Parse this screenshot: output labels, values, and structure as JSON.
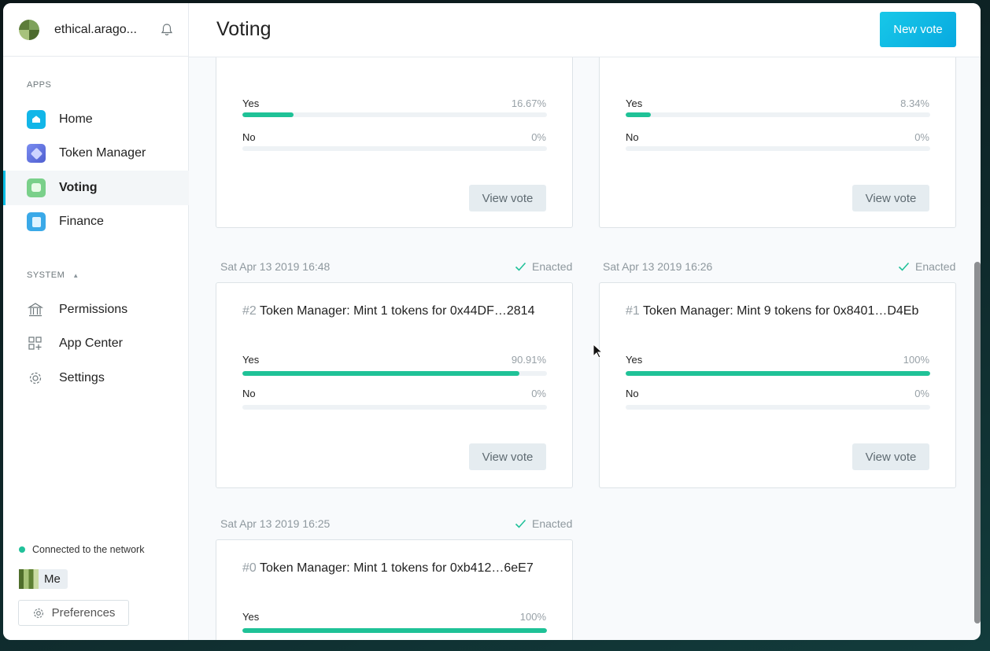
{
  "org": {
    "name": "ethical.arago..."
  },
  "sidebar": {
    "apps_label": "APPS",
    "apps": [
      {
        "label": "Home",
        "icon": "home-icon"
      },
      {
        "label": "Token Manager",
        "icon": "token-manager-icon"
      },
      {
        "label": "Voting",
        "icon": "voting-icon",
        "active": true
      },
      {
        "label": "Finance",
        "icon": "finance-icon"
      }
    ],
    "system_label": "SYSTEM",
    "system": [
      {
        "label": "Permissions",
        "icon": "bank-icon"
      },
      {
        "label": "App Center",
        "icon": "grid-plus-icon"
      },
      {
        "label": "Settings",
        "icon": "gear-icon"
      }
    ],
    "network_status": "Connected to the network",
    "user_label": "Me",
    "preferences_label": "Preferences"
  },
  "header": {
    "title": "Voting",
    "new_vote_label": "New vote"
  },
  "votes": {
    "top_left": {
      "yes_label": "Yes",
      "yes_pct": "16.67%",
      "yes_fraction": 0.1667,
      "no_label": "No",
      "no_pct": "0%",
      "no_fraction": 0,
      "button": "View vote"
    },
    "top_right": {
      "yes_label": "Yes",
      "yes_pct": "8.34%",
      "yes_fraction": 0.0834,
      "no_label": "No",
      "no_pct": "0%",
      "no_fraction": 0,
      "button": "View vote"
    },
    "v2": {
      "date": "Sat Apr 13 2019 16:48",
      "status": "Enacted",
      "number": "#2",
      "title": "Token Manager: Mint 1 tokens for 0x44DF…2814",
      "yes_label": "Yes",
      "yes_pct": "90.91%",
      "yes_fraction": 0.9091,
      "no_label": "No",
      "no_pct": "0%",
      "no_fraction": 0,
      "button": "View vote"
    },
    "v1": {
      "date": "Sat Apr 13 2019 16:26",
      "status": "Enacted",
      "number": "#1",
      "title": "Token Manager: Mint 9 tokens for 0x8401…D4Eb",
      "yes_label": "Yes",
      "yes_pct": "100%",
      "yes_fraction": 1.0,
      "no_label": "No",
      "no_pct": "0%",
      "no_fraction": 0,
      "button": "View vote"
    },
    "v0": {
      "date": "Sat Apr 13 2019 16:25",
      "status": "Enacted",
      "number": "#0",
      "title": "Token Manager: Mint 1 tokens for 0xb412…6eE7",
      "yes_label": "Yes",
      "yes_pct": "100%",
      "yes_fraction": 1.0
    }
  },
  "colors": {
    "accent": "#08bee5",
    "bar_fill": "#1fc297",
    "enacted": "#21c19a"
  }
}
